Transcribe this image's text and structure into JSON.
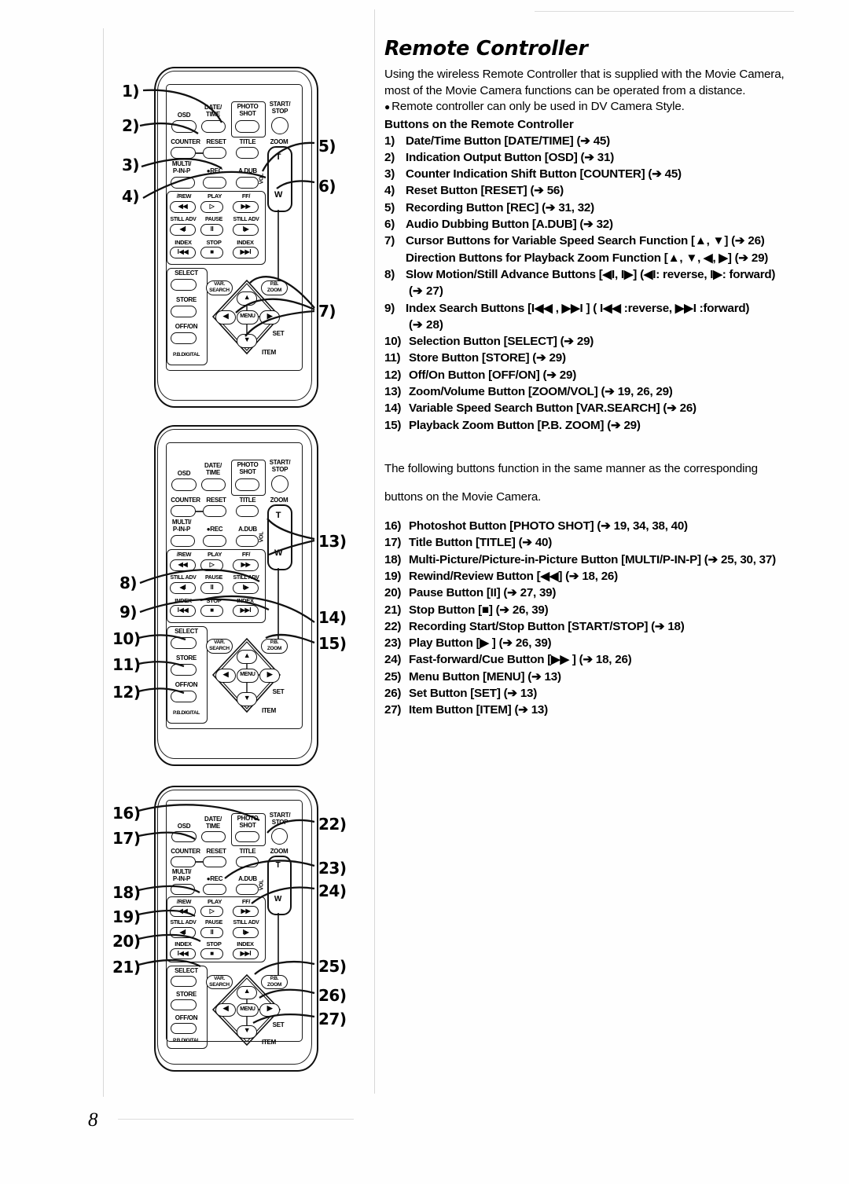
{
  "page": {
    "number": "8"
  },
  "section": {
    "title": "Remote Controller",
    "intro_line1": "Using the wireless Remote Controller that is supplied with the Movie Camera,",
    "intro_line2": "most of the Movie Camera functions can be operated from a distance.",
    "bullet1": "Remote controller can only be used in DV Camera Style.",
    "subhead": "Buttons on the Remote Controller",
    "mid_para_line1": "The following buttons function in the same manner as the corresponding",
    "mid_para_line2": "buttons on the Movie Camera."
  },
  "button_list": [
    {
      "num": "1)",
      "text": "Date/Time Button [DATE/TIME] (➔ 45)"
    },
    {
      "num": "2)",
      "text": "Indication Output Button [OSD] (➔ 31)"
    },
    {
      "num": "3)",
      "text": "Counter Indication Shift Button [COUNTER] (➔ 45)"
    },
    {
      "num": "4)",
      "text": "Reset Button [RESET] (➔ 56)"
    },
    {
      "num": "5)",
      "text": "Recording Button [REC] (➔ 31, 32)"
    },
    {
      "num": "6)",
      "text": "Audio Dubbing Button [A.DUB] (➔ 32)"
    },
    {
      "num": "7)",
      "text": "Cursor Buttons for Variable Speed Search Function [▲, ▼] (➔ 26)",
      "sub": "Direction Buttons for Playback Zoom Function [▲, ▼, ◀, ▶] (➔ 29)"
    },
    {
      "num": "8)",
      "text": "Slow Motion/Still Advance Buttons [◀I, I▶] (◀I:  reverse, I▶:  forward)",
      "cont": "(➔ 27)"
    },
    {
      "num": "9)",
      "text": "Index Search Buttons [I◀◀ , ▶▶I ] ( I◀◀ :reverse,  ▶▶I :forward)",
      "cont": "(➔ 28)"
    },
    {
      "num": "10)",
      "text": "Selection Button [SELECT] (➔ 29)"
    },
    {
      "num": "11)",
      "text": "Store Button [STORE] (➔ 29)"
    },
    {
      "num": "12)",
      "text": "Off/On Button [OFF/ON] (➔ 29)"
    },
    {
      "num": "13)",
      "text": "Zoom/Volume Button [ZOOM/VOL] (➔ 19, 26, 29)"
    },
    {
      "num": "14)",
      "text": "Variable Speed Search Button [VAR.SEARCH] (➔ 26)"
    },
    {
      "num": "15)",
      "text": "Playback Zoom Button [P.B. ZOOM] (➔ 29)"
    }
  ],
  "button_list2": [
    {
      "num": "16)",
      "text": "Photoshot Button [PHOTO SHOT] (➔ 19, 34, 38, 40)"
    },
    {
      "num": "17)",
      "text": "Title Button [TITLE] (➔ 40)"
    },
    {
      "num": "18)",
      "text": "Multi-Picture/Picture-in-Picture Button [MULTI/P-IN-P] (➔ 25, 30, 37)"
    },
    {
      "num": "19)",
      "text": "Rewind/Review Button [◀◀] (➔ 18, 26)"
    },
    {
      "num": "20)",
      "text": "Pause Button [II] (➔ 27, 39)"
    },
    {
      "num": "21)",
      "text": "Stop Button [■] (➔ 26, 39)"
    },
    {
      "num": "22)",
      "text": "Recording Start/Stop Button [START/STOP] (➔ 18)"
    },
    {
      "num": "23)",
      "text": "Play Button [▶ ] (➔ 26, 39)"
    },
    {
      "num": "24)",
      "text": "Fast-forward/Cue Button [▶▶ ] (➔ 18, 26)"
    },
    {
      "num": "25)",
      "text": "Menu Button [MENU] (➔ 13)"
    },
    {
      "num": "26)",
      "text": "Set Button [SET] (➔ 13)"
    },
    {
      "num": "27)",
      "text": "Item Button [ITEM] (➔ 13)"
    }
  ],
  "remote_labels": {
    "osd": "OSD",
    "date_time_l1": "DATE/",
    "date_time_l2": "TIME",
    "photo_shot_l1": "PHOTO",
    "photo_shot_l2": "SHOT",
    "start_stop_l1": "START/",
    "start_stop_l2": "STOP",
    "counter": "COUNTER",
    "reset": "RESET",
    "title": "TITLE",
    "zoom": "ZOOM",
    "multi_l1": "MULTI/",
    "multi_l2": "P-IN-P",
    "rec": "●REC",
    "adub": "A.DUB",
    "vol": "VOL",
    "t": "T",
    "w": "W",
    "rew": "/REW",
    "play": "PLAY",
    "ff": "FF/",
    "rew_glyph": "◀◀",
    "play_glyph": "▷",
    "ff_glyph": "▶▶",
    "still_adv": "STILL ADV",
    "pause": "PAUSE",
    "still_rev_glyph": "◀I",
    "pause_glyph": "II",
    "still_fwd_glyph": "I▶",
    "index": "INDEX",
    "stop": "STOP",
    "index_rev_glyph": "I◀◀",
    "stop_glyph": "■",
    "index_fwd_glyph": "▶▶I",
    "select": "SELECT",
    "store": "STORE",
    "off_on": "OFF/ON",
    "pb_digital": "P.B.DIGITAL",
    "var_l1": "VAR.",
    "var_l2": "SEARCH",
    "pbzoom_l1": "P.B.",
    "pbzoom_l2": "ZOOM",
    "menu": "MENU",
    "set": "SET",
    "item": "ITEM",
    "up_glyph": "▲",
    "down_glyph": "▼",
    "left_glyph": "◀",
    "right_glyph": "▶"
  },
  "callouts": {
    "diagram1_left": [
      "1)",
      "2)",
      "3)",
      "4)"
    ],
    "diagram1_right": [
      "5)",
      "6)",
      "7)"
    ],
    "diagram2_left": [
      "8)",
      "9)",
      "10)",
      "11)",
      "12)"
    ],
    "diagram2_right": [
      "13)",
      "14)",
      "15)"
    ],
    "diagram3_left": [
      "16)",
      "17)",
      "18)",
      "19)",
      "20)",
      "21)"
    ],
    "diagram3_right": [
      "22)",
      "23)",
      "24)",
      "25)",
      "26)",
      "27)"
    ]
  },
  "colors": {
    "ink": "#111111",
    "paper": "#ffffff"
  }
}
